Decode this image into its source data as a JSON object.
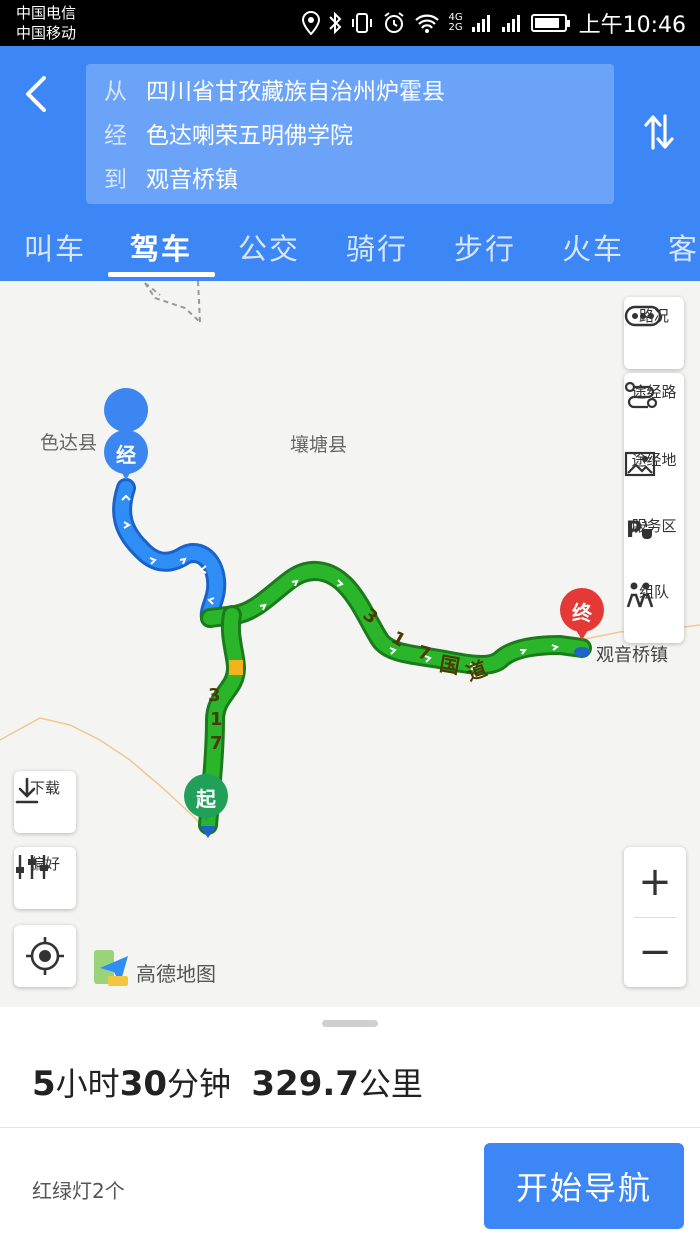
{
  "status_bar": {
    "carrier_1": "中国电信",
    "carrier_2": "中国移动",
    "network_1": "4G",
    "network_2": "2G",
    "time": "上午10:46"
  },
  "route": {
    "from_prefix": "从",
    "from": "四川省甘孜藏族自治州炉霍县",
    "via_prefix": "经",
    "via": "色达喇荣五明佛学院",
    "to_prefix": "到",
    "to": "观音桥镇"
  },
  "tabs": [
    "叫车",
    "驾车",
    "公交",
    "骑行",
    "步行",
    "火车",
    "客"
  ],
  "active_tab": 1,
  "map": {
    "place_labels": [
      "色达县",
      "壤塘县",
      "观音桥镇"
    ],
    "road_label": "317国道",
    "road_chars": [
      "3",
      "1",
      "7",
      "国",
      "道"
    ],
    "road_chars_left": [
      "3",
      "1",
      "7"
    ],
    "pins": {
      "via": "经",
      "start": "起",
      "end": "终"
    },
    "logo": "高德地图",
    "route_colors": {
      "blue": "#2f8ef5",
      "green": "#2bb52b",
      "yellow": "#f3b21b"
    }
  },
  "controls": {
    "traffic": "路况",
    "waypoint_route": "途经路",
    "waypoint_place": "途经地",
    "service_area": "服务区",
    "team": "组队",
    "download": "下载",
    "preference": "偏好",
    "zoom_in": "+",
    "zoom_out": "−"
  },
  "summary": {
    "hours": "5",
    "hours_unit": "小时",
    "minutes": "30",
    "minutes_unit": "分钟",
    "distance": "329.7",
    "distance_unit": "公里",
    "traffic_lights": "红绿灯2个",
    "start_button": "开始导航"
  }
}
